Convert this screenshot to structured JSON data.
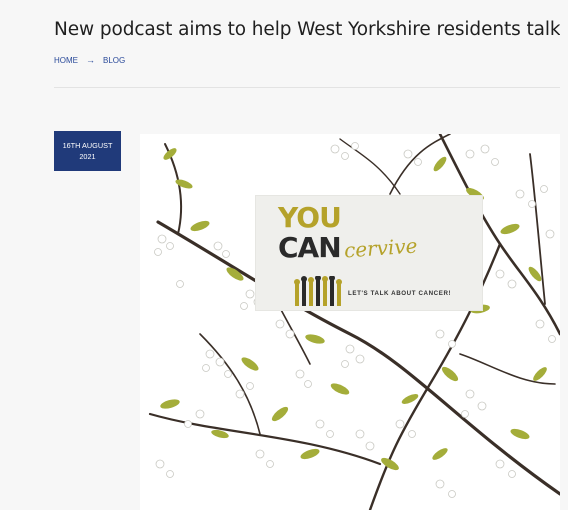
{
  "article": {
    "title": "New podcast aims to help West Yorkshire residents talk about cancer"
  },
  "breadcrumb": {
    "home": "HOME",
    "separator": "→",
    "current": "BLOG"
  },
  "date": {
    "day_month": "16TH AUGUST",
    "year": "2021"
  },
  "featured_image": {
    "logo": {
      "line1": "YOU",
      "line2": "CAN",
      "script": "cervive",
      "tagline": "LET'S TALK ABOUT CANCER!"
    }
  },
  "colors": {
    "accent": "#203a7a",
    "link": "#2a4a9a",
    "logo_gold": "#b5a22a",
    "logo_dark": "#2a2a2a"
  }
}
